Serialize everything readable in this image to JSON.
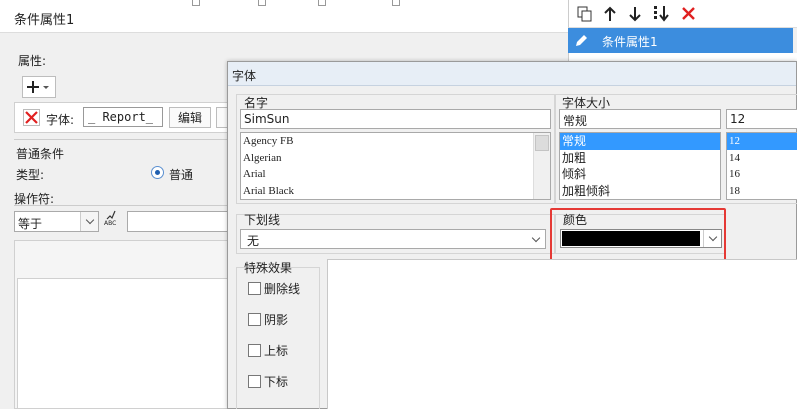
{
  "background_window": {
    "title": "条件属性1",
    "properties_label": "属性:",
    "font_label": "字体:",
    "font_value": "_ Report_",
    "edit_button": "编辑",
    "normal_condition_label": "普通条件",
    "type_label": "类型:",
    "type_option": "普通",
    "operator_label": "操作符:",
    "operator_value": "等于",
    "abc_text": "ABC"
  },
  "right_panel": {
    "item_label": "条件属性1"
  },
  "dialog": {
    "title": "字体",
    "name_label": "名字",
    "name_value": "SimSun",
    "font_list": [
      "Agency FB",
      "Algerian",
      "Arial",
      "Arial Black"
    ],
    "size_label": "字体大小",
    "style_value": "常规",
    "style_list": [
      "常规",
      "加粗",
      "倾斜",
      "加粗倾斜"
    ],
    "style_selected_index": 0,
    "size_value": "12",
    "size_list": [
      "12",
      "14",
      "16",
      "18"
    ],
    "size_selected_index": 0,
    "underline_label": "下划线",
    "underline_value": "无",
    "color_label": "颜色",
    "color_value": "#000000",
    "effects_label": "特殊效果",
    "effects": [
      "删除线",
      "阴影",
      "上标",
      "下标"
    ]
  },
  "colors": {
    "accent": "#3c8dde",
    "selection": "#3399ff",
    "highlight_frame": "#e53935",
    "delete_red": "#e02020"
  }
}
